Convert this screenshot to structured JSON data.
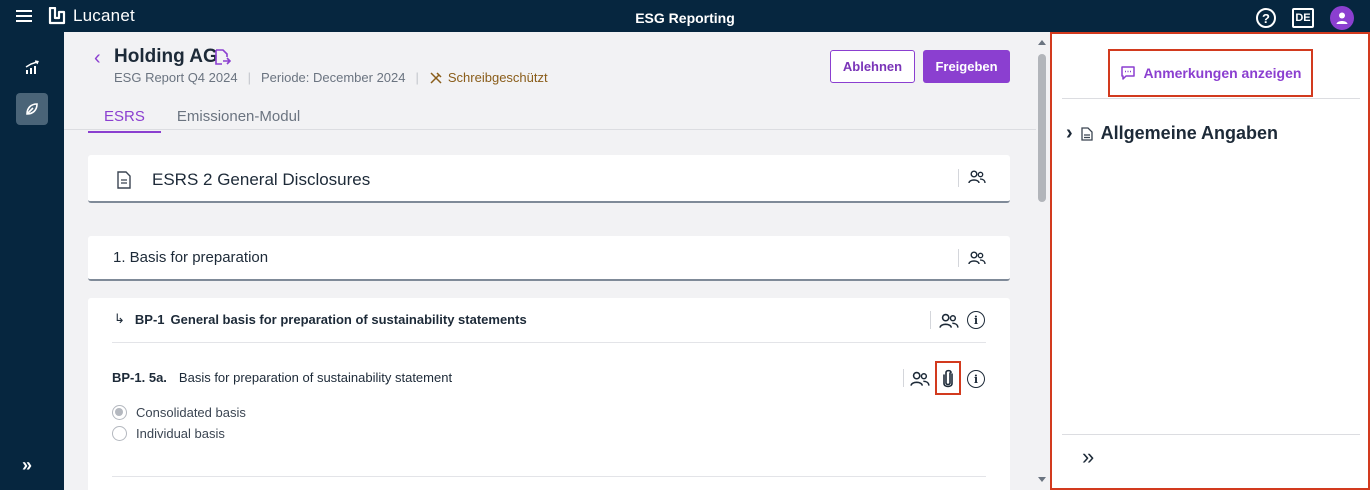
{
  "topbar": {
    "logo_text": "Lucanet",
    "app_title": "ESG Reporting",
    "language": "DE",
    "icons": [
      "menu-icon",
      "help-icon",
      "user-icon"
    ]
  },
  "sidebar": {
    "items": [
      {
        "icon": "chart-icon",
        "active": false
      },
      {
        "icon": "leaf-icon",
        "active": true
      }
    ],
    "expand_label": "»"
  },
  "header": {
    "back_icon": "‹",
    "title": "Holding AG",
    "report": "ESG Report Q4 2024",
    "period": "Periode: December 2024",
    "readonly": "Schreibgeschützt",
    "reject_label": "Ablehnen",
    "release_label": "Freigeben",
    "tabs": [
      {
        "label": "ESRS",
        "active": true
      },
      {
        "label": "Emissionen-Modul",
        "active": false
      }
    ]
  },
  "content": {
    "section_title": "ESRS 2 General Disclosures",
    "subsection_title": "1. Basis for preparation",
    "bp_arrow": "↳",
    "bp_code": "BP-1",
    "bp_title": "General basis for preparation of sustainability statements",
    "bp_item_code": "BP-1. 5a.",
    "bp_item_text": "Basis for preparation of sustainability statement",
    "options": [
      {
        "label": "Consolidated basis",
        "selected": true
      },
      {
        "label": "Individual basis",
        "selected": false
      }
    ]
  },
  "right_panel": {
    "notes_label": "Anmerkungen anzeigen",
    "tree_chevron": "›",
    "tree_item": "Allgemeine Angaben",
    "expand_label": "»"
  },
  "colors": {
    "accent": "#8b3fd0",
    "navy": "#06263f",
    "highlight": "#d23a1e"
  }
}
